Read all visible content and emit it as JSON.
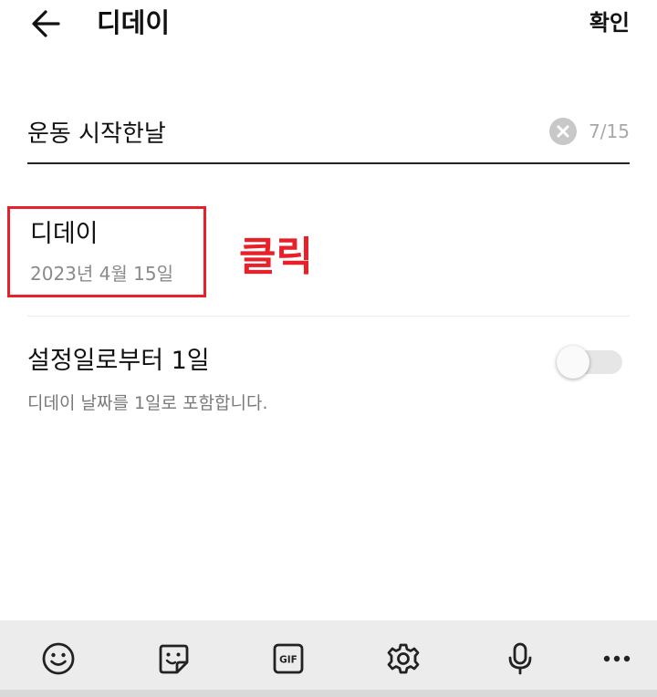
{
  "header": {
    "back_icon": "arrow-left-icon",
    "title": "디데이",
    "confirm_label": "확인"
  },
  "name_field": {
    "value": "운동 시작한날",
    "char_count": "7/15",
    "clear_icon": "clear-circle-icon"
  },
  "dday": {
    "label": "디데이",
    "date": "2023년 4월 15일"
  },
  "annotation": {
    "text": "클릭",
    "color": "#e8202a"
  },
  "setting": {
    "title": "설정일로부터 1일",
    "description": "디데이 날짜를 1일로 포함합니다.",
    "enabled": false
  },
  "keyboard_toolbar": {
    "items": [
      "emoji-icon",
      "sticker-icon",
      "gif-icon",
      "settings-gear-icon",
      "microphone-icon",
      "more-icon"
    ],
    "gif_label": "GIF"
  }
}
